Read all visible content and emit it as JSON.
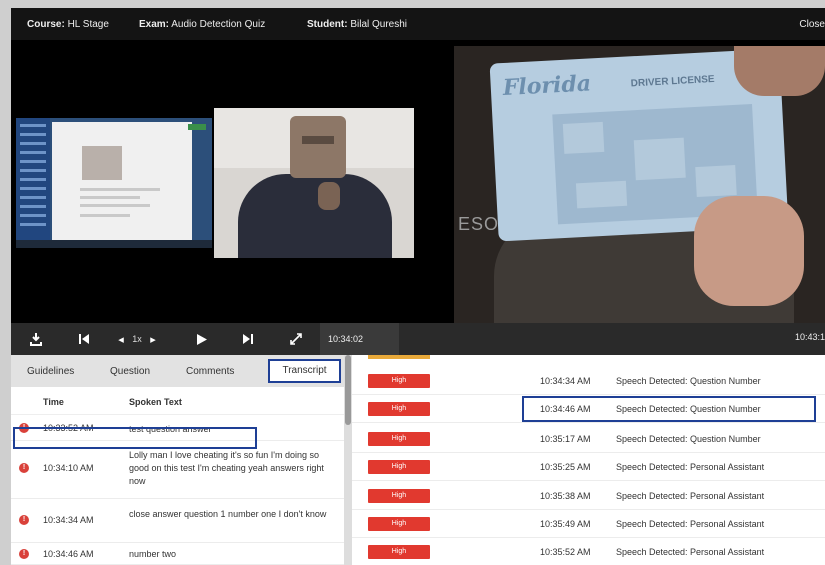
{
  "header": {
    "course_label": "Course:",
    "course_value": "HL Stage",
    "exam_label": "Exam:",
    "exam_value": "Audio Detection Quiz",
    "student_label": "Student:",
    "student_value": "Bilal Qureshi",
    "close_label": "Close"
  },
  "video": {
    "id_state_text": "Florida",
    "id_type_text": "DRIVER LICENSE",
    "background_text": "ESOME"
  },
  "controls": {
    "speed": "1x",
    "current_time": "10:34:02",
    "end_time": "10:43:1"
  },
  "tabs": {
    "guidelines": "Guidelines",
    "question": "Question",
    "comments": "Comments",
    "transcript": "Transcript"
  },
  "transcript": {
    "col_time": "Time",
    "col_spoken": "Spoken Text",
    "rows": [
      {
        "time": "10:33:52 AM",
        "text": "test question answer"
      },
      {
        "time": "10:34:10 AM",
        "text": "Lolly man I love cheating it's so fun I'm doing so good on this test I'm cheating yeah answers right now"
      },
      {
        "time": "10:34:34 AM",
        "text": "close answer question 1 number one I don't know"
      },
      {
        "time": "10:34:46 AM",
        "text": "number two"
      }
    ]
  },
  "events": {
    "rows": [
      {
        "severity": "High",
        "time": "10:34:34 AM",
        "event": "Speech Detected: Question Number"
      },
      {
        "severity": "High",
        "time": "10:34:46 AM",
        "event": "Speech Detected: Question Number"
      },
      {
        "severity": "High",
        "time": "10:35:17 AM",
        "event": "Speech Detected: Question Number"
      },
      {
        "severity": "High",
        "time": "10:35:25 AM",
        "event": "Speech Detected: Personal Assistant"
      },
      {
        "severity": "High",
        "time": "10:35:38 AM",
        "event": "Speech Detected: Personal Assistant"
      },
      {
        "severity": "High",
        "time": "10:35:49 AM",
        "event": "Speech Detected: Personal Assistant"
      },
      {
        "severity": "High",
        "time": "10:35:52 AM",
        "event": "Speech Detected: Personal Assistant"
      }
    ]
  },
  "colors": {
    "highlight_box": "#1e3f95",
    "severity_high": "#e1392f",
    "warning_icon": "#d9413a"
  }
}
